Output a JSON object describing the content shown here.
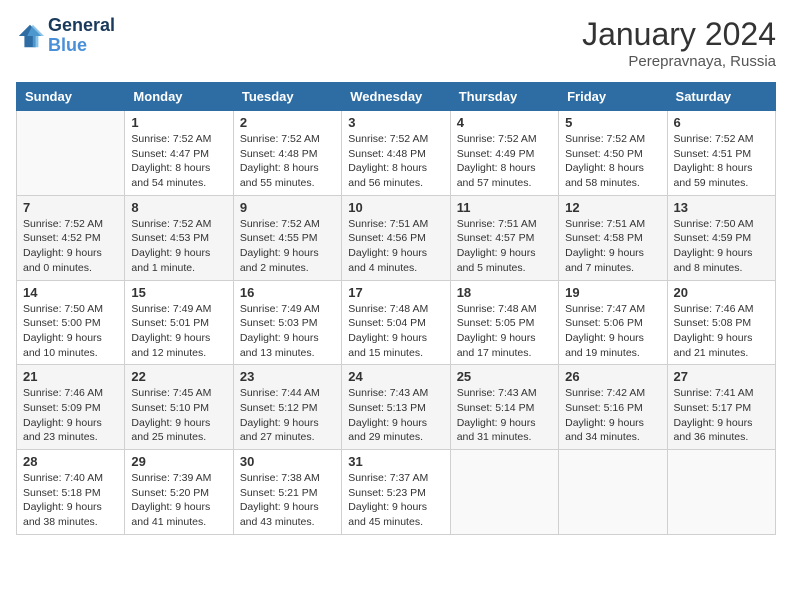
{
  "logo": {
    "line1": "General",
    "line2": "Blue"
  },
  "title": "January 2024",
  "subtitle": "Perepravnaya, Russia",
  "weekdays": [
    "Sunday",
    "Monday",
    "Tuesday",
    "Wednesday",
    "Thursday",
    "Friday",
    "Saturday"
  ],
  "weeks": [
    [
      {
        "day": "",
        "info": ""
      },
      {
        "day": "1",
        "info": "Sunrise: 7:52 AM\nSunset: 4:47 PM\nDaylight: 8 hours\nand 54 minutes."
      },
      {
        "day": "2",
        "info": "Sunrise: 7:52 AM\nSunset: 4:48 PM\nDaylight: 8 hours\nand 55 minutes."
      },
      {
        "day": "3",
        "info": "Sunrise: 7:52 AM\nSunset: 4:48 PM\nDaylight: 8 hours\nand 56 minutes."
      },
      {
        "day": "4",
        "info": "Sunrise: 7:52 AM\nSunset: 4:49 PM\nDaylight: 8 hours\nand 57 minutes."
      },
      {
        "day": "5",
        "info": "Sunrise: 7:52 AM\nSunset: 4:50 PM\nDaylight: 8 hours\nand 58 minutes."
      },
      {
        "day": "6",
        "info": "Sunrise: 7:52 AM\nSunset: 4:51 PM\nDaylight: 8 hours\nand 59 minutes."
      }
    ],
    [
      {
        "day": "7",
        "info": "Sunrise: 7:52 AM\nSunset: 4:52 PM\nDaylight: 9 hours\nand 0 minutes."
      },
      {
        "day": "8",
        "info": "Sunrise: 7:52 AM\nSunset: 4:53 PM\nDaylight: 9 hours\nand 1 minute."
      },
      {
        "day": "9",
        "info": "Sunrise: 7:52 AM\nSunset: 4:55 PM\nDaylight: 9 hours\nand 2 minutes."
      },
      {
        "day": "10",
        "info": "Sunrise: 7:51 AM\nSunset: 4:56 PM\nDaylight: 9 hours\nand 4 minutes."
      },
      {
        "day": "11",
        "info": "Sunrise: 7:51 AM\nSunset: 4:57 PM\nDaylight: 9 hours\nand 5 minutes."
      },
      {
        "day": "12",
        "info": "Sunrise: 7:51 AM\nSunset: 4:58 PM\nDaylight: 9 hours\nand 7 minutes."
      },
      {
        "day": "13",
        "info": "Sunrise: 7:50 AM\nSunset: 4:59 PM\nDaylight: 9 hours\nand 8 minutes."
      }
    ],
    [
      {
        "day": "14",
        "info": "Sunrise: 7:50 AM\nSunset: 5:00 PM\nDaylight: 9 hours\nand 10 minutes."
      },
      {
        "day": "15",
        "info": "Sunrise: 7:49 AM\nSunset: 5:01 PM\nDaylight: 9 hours\nand 12 minutes."
      },
      {
        "day": "16",
        "info": "Sunrise: 7:49 AM\nSunset: 5:03 PM\nDaylight: 9 hours\nand 13 minutes."
      },
      {
        "day": "17",
        "info": "Sunrise: 7:48 AM\nSunset: 5:04 PM\nDaylight: 9 hours\nand 15 minutes."
      },
      {
        "day": "18",
        "info": "Sunrise: 7:48 AM\nSunset: 5:05 PM\nDaylight: 9 hours\nand 17 minutes."
      },
      {
        "day": "19",
        "info": "Sunrise: 7:47 AM\nSunset: 5:06 PM\nDaylight: 9 hours\nand 19 minutes."
      },
      {
        "day": "20",
        "info": "Sunrise: 7:46 AM\nSunset: 5:08 PM\nDaylight: 9 hours\nand 21 minutes."
      }
    ],
    [
      {
        "day": "21",
        "info": "Sunrise: 7:46 AM\nSunset: 5:09 PM\nDaylight: 9 hours\nand 23 minutes."
      },
      {
        "day": "22",
        "info": "Sunrise: 7:45 AM\nSunset: 5:10 PM\nDaylight: 9 hours\nand 25 minutes."
      },
      {
        "day": "23",
        "info": "Sunrise: 7:44 AM\nSunset: 5:12 PM\nDaylight: 9 hours\nand 27 minutes."
      },
      {
        "day": "24",
        "info": "Sunrise: 7:43 AM\nSunset: 5:13 PM\nDaylight: 9 hours\nand 29 minutes."
      },
      {
        "day": "25",
        "info": "Sunrise: 7:43 AM\nSunset: 5:14 PM\nDaylight: 9 hours\nand 31 minutes."
      },
      {
        "day": "26",
        "info": "Sunrise: 7:42 AM\nSunset: 5:16 PM\nDaylight: 9 hours\nand 34 minutes."
      },
      {
        "day": "27",
        "info": "Sunrise: 7:41 AM\nSunset: 5:17 PM\nDaylight: 9 hours\nand 36 minutes."
      }
    ],
    [
      {
        "day": "28",
        "info": "Sunrise: 7:40 AM\nSunset: 5:18 PM\nDaylight: 9 hours\nand 38 minutes."
      },
      {
        "day": "29",
        "info": "Sunrise: 7:39 AM\nSunset: 5:20 PM\nDaylight: 9 hours\nand 41 minutes."
      },
      {
        "day": "30",
        "info": "Sunrise: 7:38 AM\nSunset: 5:21 PM\nDaylight: 9 hours\nand 43 minutes."
      },
      {
        "day": "31",
        "info": "Sunrise: 7:37 AM\nSunset: 5:23 PM\nDaylight: 9 hours\nand 45 minutes."
      },
      {
        "day": "",
        "info": ""
      },
      {
        "day": "",
        "info": ""
      },
      {
        "day": "",
        "info": ""
      }
    ]
  ]
}
